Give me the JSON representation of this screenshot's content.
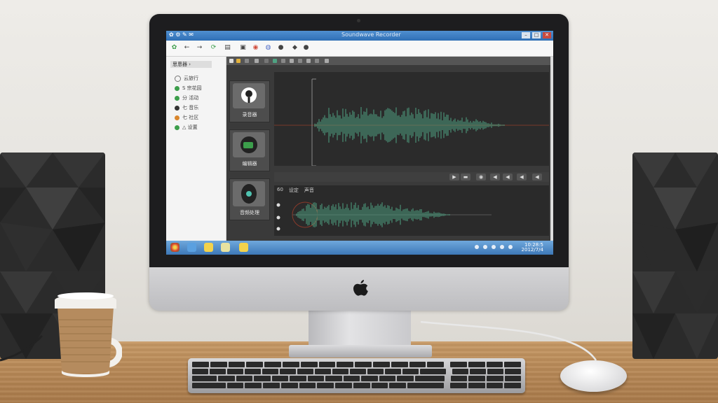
{
  "scene": {
    "description_colors": {
      "wall": "#e9e7e3",
      "desk": "#b98a58",
      "waveform": "#4fa383",
      "app_background": "#3a3a3a",
      "taskbar": "#3d78b8"
    }
  },
  "window": {
    "title": "Soundwave Recorder",
    "left_label": "✿ ⚙ ✎ ✉",
    "buttons": [
      "–",
      "□",
      "✕"
    ]
  },
  "toolbar": {
    "icons": [
      "logo-icon",
      "back-icon",
      "forward-icon",
      "refresh-icon",
      "page-icon",
      "shield-icon",
      "chrome-icon",
      "globe-icon",
      "camera-icon",
      "settings-icon"
    ]
  },
  "sidebar": {
    "header": "思恩器 ›",
    "items": [
      {
        "label": "云旅行",
        "color": "#777"
      },
      {
        "label": "S 宗花园",
        "color": "#3c9e4b"
      },
      {
        "label": "分 活动",
        "color": "#3c9e4b"
      },
      {
        "label": "七 音乐",
        "color": "#333"
      },
      {
        "label": "七 社区",
        "color": "#d9862d"
      },
      {
        "label": "△ 设置",
        "color": "#3c9e4b"
      }
    ]
  },
  "app": {
    "panels": [
      {
        "caption": "录音器",
        "icon": "microphone-icon"
      },
      {
        "caption": "编辑器",
        "icon": "headset-icon"
      },
      {
        "caption": "音频处理",
        "icon": "speaker-icon"
      }
    ],
    "bottom_header": [
      "60",
      "设定",
      "声音"
    ],
    "controls": [
      "▶",
      "▬",
      "◉",
      "◀",
      "◀",
      "◀",
      "◀"
    ]
  },
  "taskbar": {
    "time": "10:28:5",
    "date": "2012/7/4"
  }
}
